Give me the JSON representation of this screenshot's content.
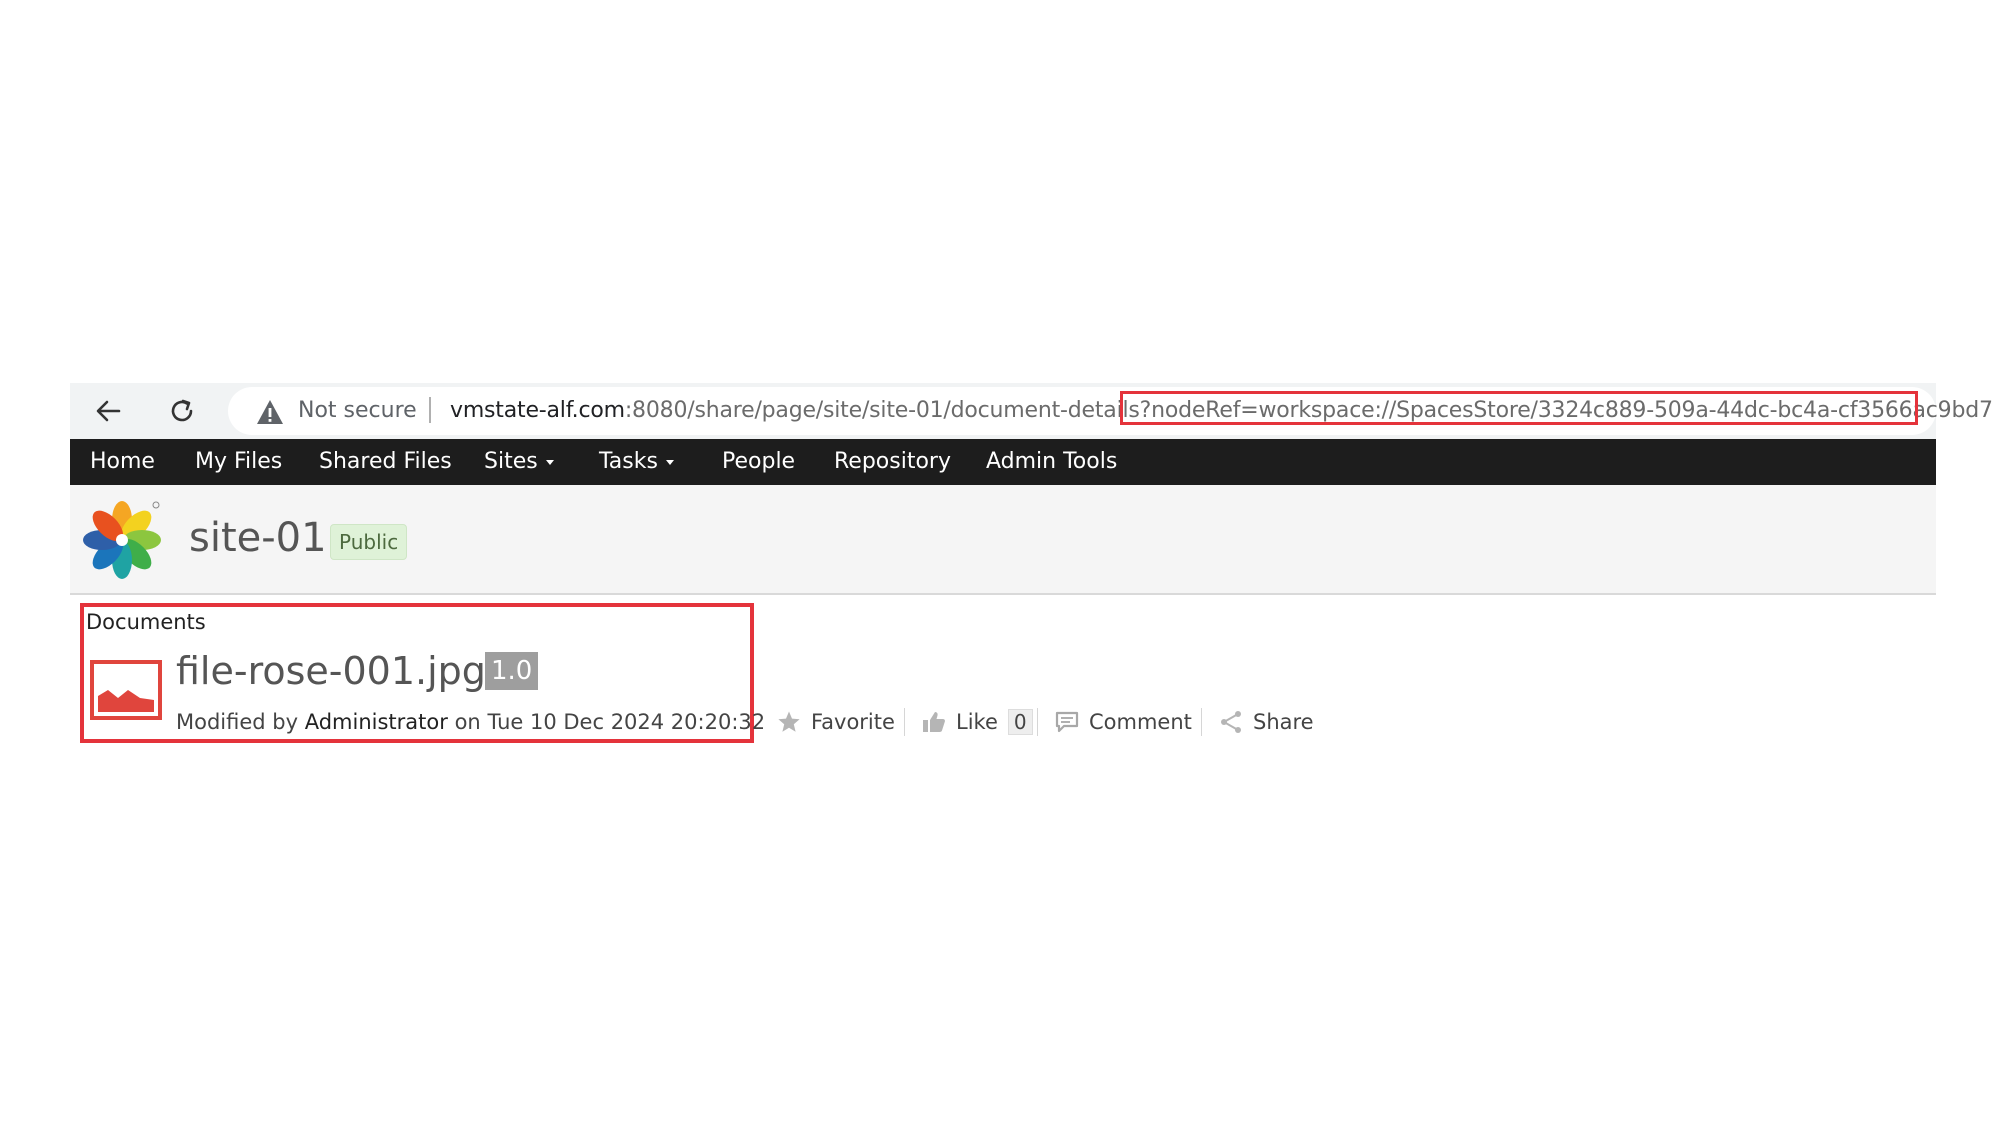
{
  "browser": {
    "security_label": "Not secure",
    "url_domain": "vmstate-alf.com",
    "url_path": ":8080/share/page/site/site-01/document-details?",
    "url_query": "nodeRef=workspace://SpacesStore/3324c889-509a-44dc-bc4a-cf3566ac9bd7"
  },
  "app_menu": {
    "home": "Home",
    "my_files": "My Files",
    "shared_files": "Shared Files",
    "sites": "Sites",
    "tasks": "Tasks",
    "people": "People",
    "repository": "Repository",
    "admin_tools": "Admin Tools"
  },
  "site": {
    "title": "site-01",
    "visibility": "Public"
  },
  "document": {
    "breadcrumb": "Documents",
    "file_name": "file-rose-001.jpg",
    "version": "1.0",
    "modified_prefix": "Modified by",
    "modified_by": "Administrator",
    "modified_on_prefix": "on",
    "modified_date": "Tue 10 Dec 2024 20:20:32"
  },
  "actions": {
    "favorite": "Favorite",
    "like": "Like",
    "like_count": "0",
    "comment": "Comment",
    "share": "Share"
  },
  "colors": {
    "highlight": "#e4333b",
    "header_bg": "#1d1d1d",
    "file_icon": "#e0453d"
  }
}
